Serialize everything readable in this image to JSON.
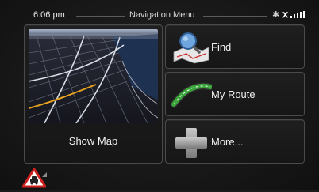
{
  "status": {
    "time": "6:06 pm",
    "title": "Navigation Menu",
    "bluetooth_icon": "bluetooth-icon",
    "gps_icon": "gps-satellite-icon",
    "signal_icon": "signal-strength-icon"
  },
  "tiles": {
    "show_map": {
      "label": "Show Map",
      "icon": "3d-map-preview"
    },
    "find": {
      "label": "Find",
      "icon": "magnifier-map-icon"
    },
    "my_route": {
      "label": "My Route",
      "icon": "route-arc-icon"
    },
    "more": {
      "label": "More...",
      "icon": "plus-icon"
    }
  },
  "footer": {
    "warning_icon": "traffic-warning-icon"
  },
  "colors": {
    "background": "#161616",
    "tile_border": "#4a4a4a",
    "text": "#f0f0f0",
    "route_green": "#3aa53a",
    "plus_gray": "#9a9a9a",
    "warning_red": "#d02020"
  }
}
